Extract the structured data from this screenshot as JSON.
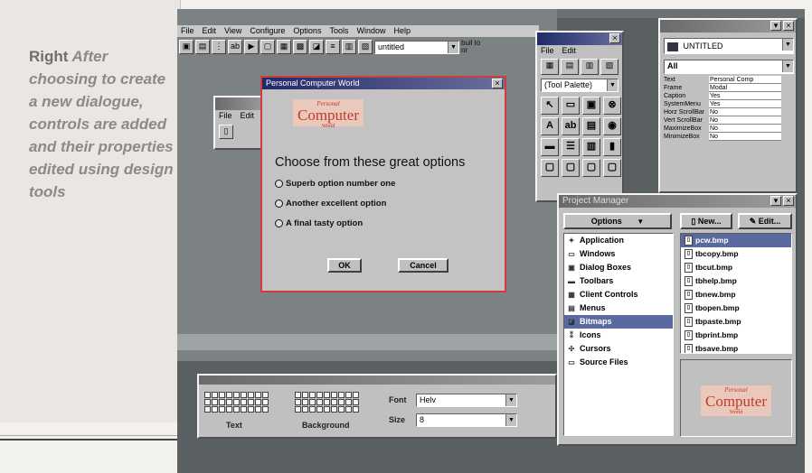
{
  "caption": {
    "lead": "Right",
    "body": "After choosing to create a new dialogue, controls are added and their properties edited using design tools"
  },
  "ide": {
    "menu": [
      "File",
      "Edit",
      "View",
      "Configure",
      "Options",
      "Tools",
      "Window",
      "Help"
    ],
    "toolbar_combo": "untitled",
    "toolbar_side_text": "buil to or"
  },
  "child_window": {
    "menu": [
      "File",
      "Edit"
    ]
  },
  "dialog": {
    "title": "Personal Computer World",
    "logo": [
      "Personal",
      "Computer",
      "World"
    ],
    "headline": "Choose from these great options",
    "options": [
      "Superb option number one",
      "Another excellent option",
      "A final tasty option"
    ],
    "ok_label": "OK",
    "cancel_label": "Cancel"
  },
  "tools_palette": {
    "menu": [
      "File",
      "Edit"
    ],
    "combo": "(Tool Palette)",
    "tools": [
      "A",
      "ab",
      "▤",
      "⊗",
      "▭",
      "▣",
      "▤",
      "▮",
      "▢",
      "▢",
      "▢",
      "▢"
    ]
  },
  "properties": {
    "object": "UNTITLED",
    "filter": "All",
    "rows": [
      {
        "k": "Text",
        "v": "Personal Comp"
      },
      {
        "k": "Frame",
        "v": "Modal"
      },
      {
        "k": "Caption",
        "v": "Yes"
      },
      {
        "k": "SystemMenu",
        "v": "Yes"
      },
      {
        "k": "Horz ScrollBar",
        "v": "No"
      },
      {
        "k": "Vert ScrollBar",
        "v": "No"
      },
      {
        "k": "MaximizeBox",
        "v": "No"
      },
      {
        "k": "MinimizeBox",
        "v": "No"
      }
    ]
  },
  "project_manager": {
    "title": "Project Manager",
    "options_label": "Options",
    "new_label": "New...",
    "edit_label": "Edit...",
    "tree": [
      "Application",
      "Windows",
      "Dialog Boxes",
      "Toolbars",
      "Client Controls",
      "Menus",
      "Bitmaps",
      "Icons",
      "Cursors",
      "Source Files"
    ],
    "tree_selected": "Bitmaps",
    "files": [
      "pcw.bmp",
      "tbcopy.bmp",
      "tbcut.bmp",
      "tbhelp.bmp",
      "tbnew.bmp",
      "tbopen.bmp",
      "tbpaste.bmp",
      "tbprint.bmp",
      "tbsave.bmp"
    ],
    "file_selected": "pcw.bmp",
    "preview_logo": [
      "Personal",
      "Computer",
      "World"
    ]
  },
  "font_palette": {
    "font_label": "Font",
    "font_value": "Helv",
    "size_label": "Size",
    "size_value": "8",
    "text_label": "Text",
    "background_label": "Background"
  },
  "colors": {
    "title_active": "#1f2a6b",
    "dialog_border": "#d23b3b",
    "selection": "#5a6aa0",
    "logo_red": "#c23a2a"
  }
}
